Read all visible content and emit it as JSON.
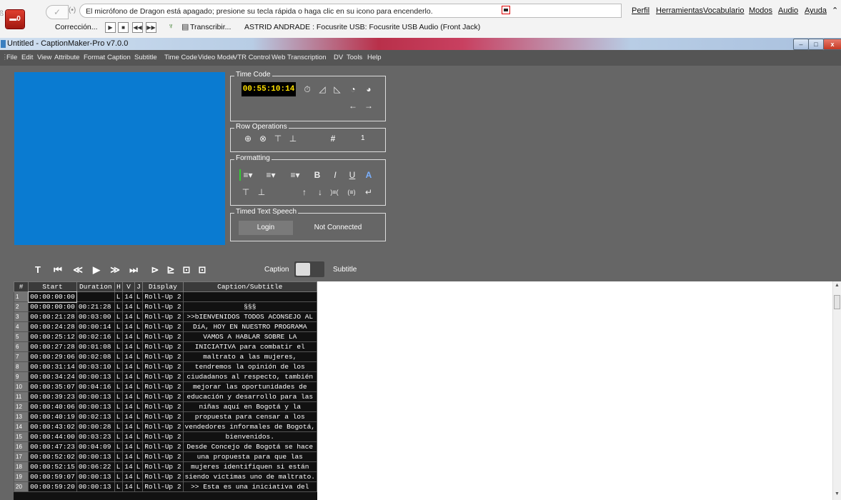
{
  "dragon": {
    "status_message": "El micrófono de Dragon está apagado; presione su tecla rápida o haga clic en su icono para encenderlo.",
    "menus": [
      "Perfil",
      "Herramientas",
      "Vocabulario",
      "Modos",
      "Audio",
      "Ayuda"
    ],
    "correction_label": "Corrección...",
    "transcribe_label": "Transcribir...",
    "profile_info": "ASTRID ANDRADE : Focusrite USB: Focusrite USB Audio (Front Jack)"
  },
  "window": {
    "title": "Untitled - CaptionMaker-Pro v7.0.0"
  },
  "menubar": [
    "File",
    "Edit",
    "View",
    "Attribute",
    "Format",
    "Caption",
    "Subtitle",
    "Time Code",
    "Video Mode",
    "VTR Control",
    "Web",
    "Transcription",
    "DV",
    "Tools",
    "Help"
  ],
  "timecode": {
    "legend": "Time Code",
    "value": "00:55:10:14"
  },
  "row_operations": {
    "legend": "Row Operations",
    "count": "1"
  },
  "formatting": {
    "legend": "Formatting"
  },
  "tts": {
    "legend": "Timed Text Speech",
    "login_label": "Login",
    "status": "Not Connected"
  },
  "mode_toggle": {
    "left": "Caption",
    "right": "Subtitle"
  },
  "grid": {
    "headers": [
      "#",
      "Start",
      "Duration",
      "H",
      "V",
      "J",
      "Display",
      "Caption/Subtitle"
    ],
    "rows": [
      [
        "1",
        "00:00:00:00",
        "",
        "L",
        "14",
        "L",
        "Roll-Up 2",
        ""
      ],
      [
        "2",
        "00:00:00:00",
        "00:21:28",
        "L",
        "14",
        "L",
        "Roll-Up 2",
        "§§§"
      ],
      [
        "3",
        "00:00:21:28",
        "00:03:00",
        "L",
        "14",
        "L",
        "Roll-Up 2",
        ">>bIENVENIDOS TODOS ACONSEJO AL"
      ],
      [
        "4",
        "00:00:24:28",
        "00:00:14",
        "L",
        "14",
        "L",
        "Roll-Up 2",
        "DíA, HOY EN NUESTRO PROGRAMA"
      ],
      [
        "5",
        "00:00:25:12",
        "00:02:16",
        "L",
        "14",
        "L",
        "Roll-Up 2",
        "VAMOS A HABLAR SOBRE LA"
      ],
      [
        "6",
        "00:00:27:28",
        "00:01:08",
        "L",
        "14",
        "L",
        "Roll-Up 2",
        "INICIATIVA para combatir el"
      ],
      [
        "7",
        "00:00:29:06",
        "00:02:08",
        "L",
        "14",
        "L",
        "Roll-Up 2",
        "maltrato a las mujeres,"
      ],
      [
        "8",
        "00:00:31:14",
        "00:03:10",
        "L",
        "14",
        "L",
        "Roll-Up 2",
        "tendremos la opinión de los"
      ],
      [
        "9",
        "00:00:34:24",
        "00:00:13",
        "L",
        "14",
        "L",
        "Roll-Up 2",
        "ciudadanos al respecto, también"
      ],
      [
        "10",
        "00:00:35:07",
        "00:04:16",
        "L",
        "14",
        "L",
        "Roll-Up 2",
        "mejorar las oportunidades de"
      ],
      [
        "11",
        "00:00:39:23",
        "00:00:13",
        "L",
        "14",
        "L",
        "Roll-Up 2",
        "educación y desarrollo para las"
      ],
      [
        "12",
        "00:00:40:06",
        "00:00:13",
        "L",
        "14",
        "L",
        "Roll-Up 2",
        "niñas aquí en Bogotá y la"
      ],
      [
        "13",
        "00:00:40:19",
        "00:02:13",
        "L",
        "14",
        "L",
        "Roll-Up 2",
        "propuesta para censar a los"
      ],
      [
        "14",
        "00:00:43:02",
        "00:00:28",
        "L",
        "14",
        "L",
        "Roll-Up 2",
        "vendedores informales de Bogotá,"
      ],
      [
        "15",
        "00:00:44:00",
        "00:03:23",
        "L",
        "14",
        "L",
        "Roll-Up 2",
        "bienvenidos."
      ],
      [
        "16",
        "00:00:47:23",
        "00:04:09",
        "L",
        "14",
        "L",
        "Roll-Up 2",
        "Desde Concejo de Bogotá se hace"
      ],
      [
        "17",
        "00:00:52:02",
        "00:00:13",
        "L",
        "14",
        "L",
        "Roll-Up 2",
        "una propuesta para que las"
      ],
      [
        "18",
        "00:00:52:15",
        "00:06:22",
        "L",
        "14",
        "L",
        "Roll-Up 2",
        "mujeres identifiquen si están"
      ],
      [
        "19",
        "00:00:59:07",
        "00:00:13",
        "L",
        "14",
        "L",
        "Roll-Up 2",
        "siendo victimas uno de maltrato."
      ],
      [
        "20",
        "00:00:59:20",
        "00:00:13",
        "L",
        "14",
        "L",
        "Roll-Up 2",
        ">> Esta es una iniciativa del"
      ]
    ]
  }
}
